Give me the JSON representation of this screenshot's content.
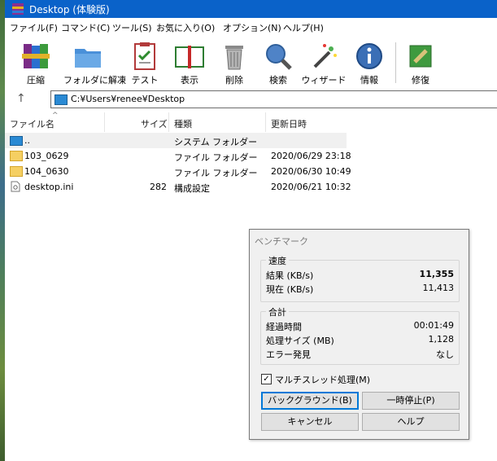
{
  "window": {
    "title": "Desktop (体験版)"
  },
  "menu": [
    "ファイル(F)",
    "コマンド(C)",
    "ツール(S)",
    "お気に入り(O)",
    "オプション(N)",
    "ヘルプ(H)"
  ],
  "toolbar": {
    "add": "圧縮",
    "extract": "フォルダに解凍",
    "test": "テスト",
    "view": "表示",
    "delete": "削除",
    "find": "検索",
    "wizard": "ウィザード",
    "info": "情報",
    "repair": "修復"
  },
  "address": {
    "path": "C:¥Users¥renee¥Desktop"
  },
  "filelist": {
    "columns": {
      "name": "ファイル名",
      "size": "サイズ",
      "type": "種類",
      "modified": "更新日時"
    },
    "rows": [
      {
        "name": "..",
        "size": "",
        "type": "システム フォルダー",
        "modified": ""
      },
      {
        "name": "103_0629",
        "size": "",
        "type": "ファイル フォルダー",
        "modified": "2020/06/29 23:18"
      },
      {
        "name": "104_0630",
        "size": "",
        "type": "ファイル フォルダー",
        "modified": "2020/06/30 10:49"
      },
      {
        "name": "desktop.ini",
        "size": "282",
        "type": "構成設定",
        "modified": "2020/06/21 10:32"
      }
    ]
  },
  "dialog": {
    "title": "ベンチマーク",
    "speed_group": "速度",
    "result_label": "結果 (KB/s)",
    "result_value": "11,355",
    "current_label": "現在 (KB/s)",
    "current_value": "11,413",
    "total_group": "合計",
    "elapsed_label": "経過時間",
    "elapsed_value": "00:01:49",
    "size_label": "処理サイズ (MB)",
    "size_value": "1,128",
    "errors_label": "エラー発見",
    "errors_value": "なし",
    "multithread_label": "マルチスレッド処理(M)",
    "multithread_checked": true,
    "background_button": "バックグラウンド(B)",
    "pause_button": "一時停止(P)",
    "cancel_button": "キャンセル",
    "help_button": "ヘルプ"
  },
  "colors": {
    "titlebar": "#0a62c9",
    "dialog_bg": "#f0f0f0",
    "selected_row": "#f0f0f0"
  }
}
